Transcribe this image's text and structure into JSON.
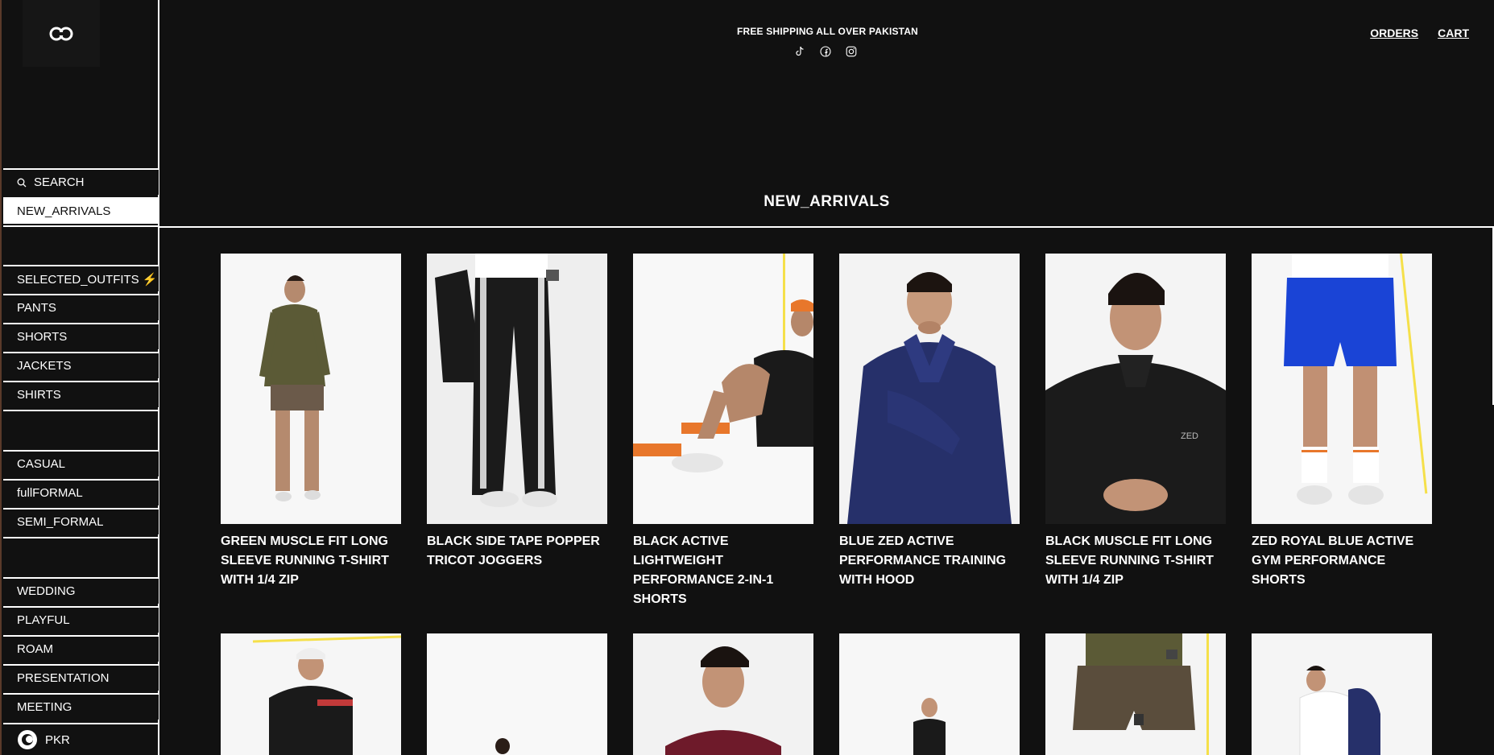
{
  "header": {
    "announcement": "FREE SHIPPING ALL OVER PAKISTAN",
    "links": {
      "orders": "ORDERS",
      "cart": "CART"
    },
    "socials": [
      "tiktok-icon",
      "facebook-icon",
      "instagram-icon"
    ]
  },
  "sidebar": {
    "search_label": "SEARCH",
    "items": {
      "new_arrivals": "NEW_ARRIVALS",
      "selected_outfits": "SELECTED_OUTFITS ⚡",
      "pants": "PANTS",
      "shorts": "SHORTS",
      "jackets": "JACKETS",
      "shirts": "SHIRTS",
      "casual": "CASUAL",
      "fullformal": "fullFORMAL",
      "semi_formal": "SEMI_FORMAL",
      "wedding": "WEDDING",
      "playful": "PLAYFUL",
      "roam": "ROAM",
      "presentation": "PRESENTATION",
      "meeting": "MEETING"
    },
    "currency": "PKR"
  },
  "main": {
    "section_title": "NEW_ARRIVALS",
    "products": [
      {
        "title": "GREEN MUSCLE FIT LONG SLEEVE RUNNING T-SHIRT WITH 1/4 ZIP"
      },
      {
        "title": "BLACK SIDE TAPE POPPER TRICOT JOGGERS"
      },
      {
        "title": "BLACK ACTIVE LIGHTWEIGHT PERFORMANCE 2-IN-1 SHORTS"
      },
      {
        "title": "BLUE ZED ACTIVE PERFORMANCE TRAINING WITH HOOD"
      },
      {
        "title": "BLACK MUSCLE FIT LONG SLEEVE RUNNING T-SHIRT WITH 1/4 ZIP"
      },
      {
        "title": "ZED ROYAL BLUE ACTIVE GYM PERFORMANCE SHORTS"
      }
    ]
  },
  "colors": {
    "background": "#111111",
    "text": "#ffffff",
    "accent_yellow": "#f5e04a"
  }
}
